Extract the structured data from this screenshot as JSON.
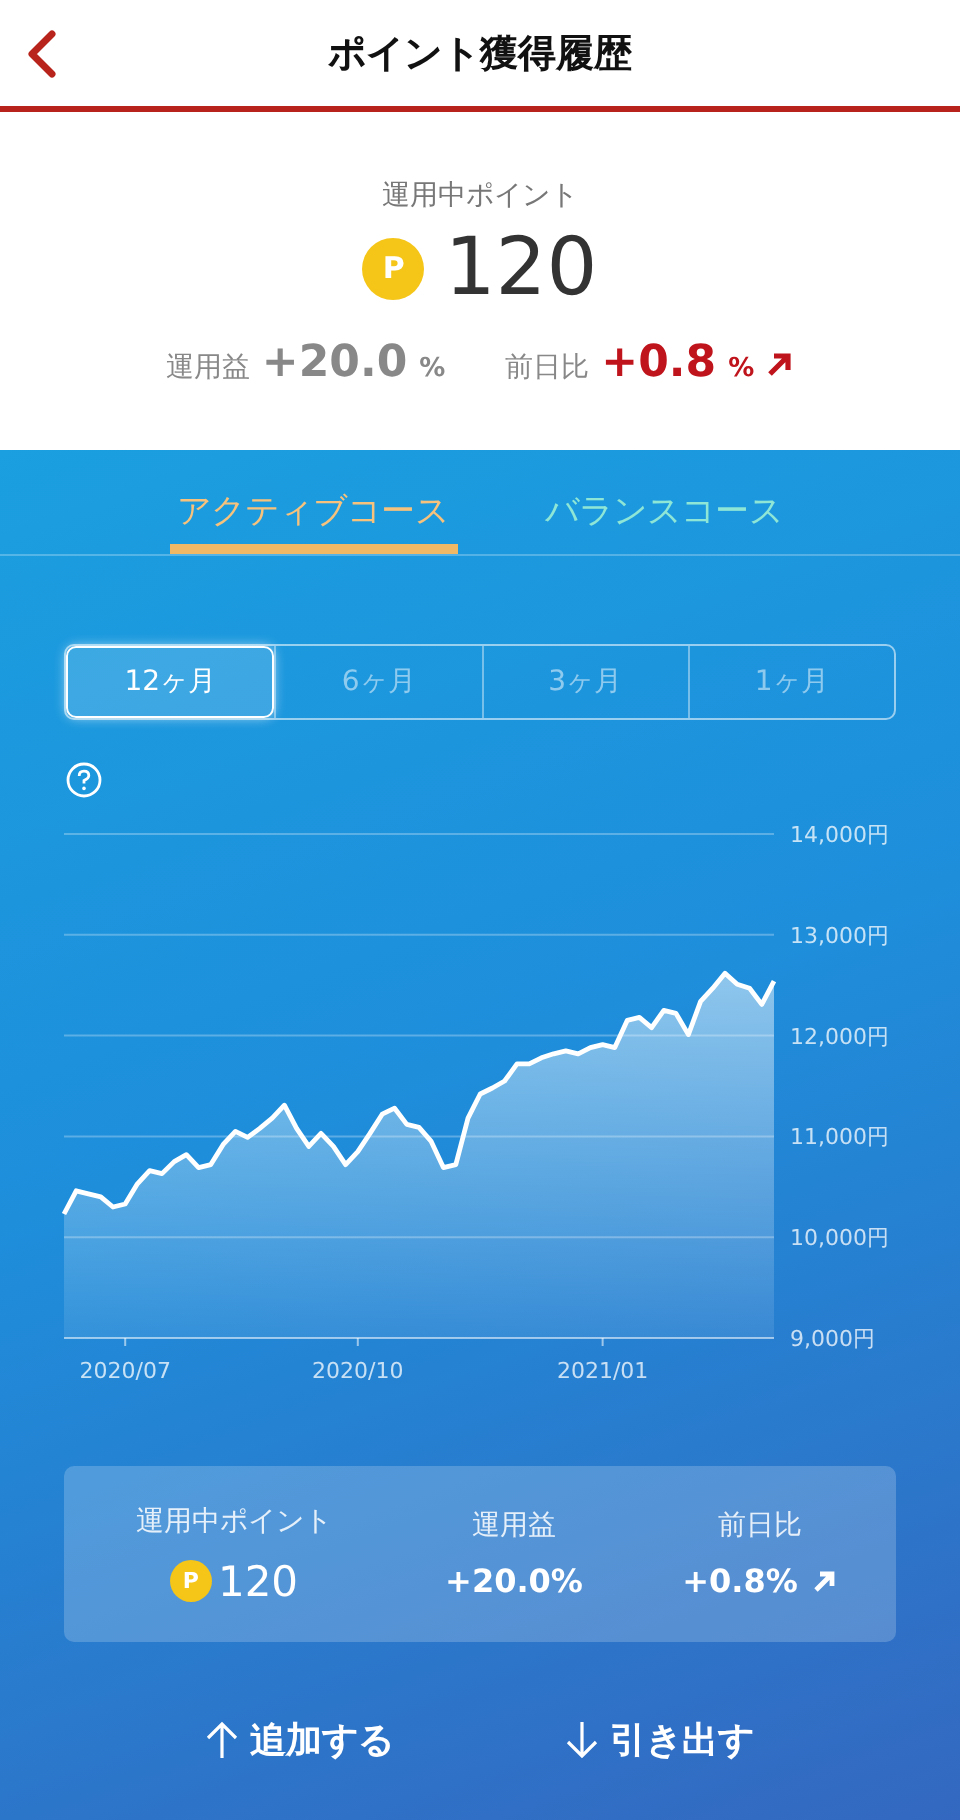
{
  "header": {
    "title": "ポイント獲得履歴"
  },
  "summary": {
    "label": "運用中ポイント",
    "coin_mark": "P",
    "points": "120",
    "profit_label": "運用益",
    "profit_value": "+20.0",
    "profit_unit": "%",
    "daychange_label": "前日比",
    "daychange_value": "+0.8",
    "daychange_unit": "%"
  },
  "course_tabs": [
    {
      "label": "アクティブコース",
      "selected": true
    },
    {
      "label": "バランスコース",
      "selected": false
    }
  ],
  "period_tabs": [
    {
      "label": "12ヶ月",
      "selected": true
    },
    {
      "label": "6ヶ月",
      "selected": false
    },
    {
      "label": "3ヶ月",
      "selected": false
    },
    {
      "label": "1ヶ月",
      "selected": false
    }
  ],
  "chart": {
    "chart_data": {
      "type": "area",
      "grid": true,
      "ylim": [
        9000,
        14000
      ],
      "categories": [
        null,
        null,
        null,
        null,
        null,
        "2020/07",
        null,
        null,
        null,
        null,
        null,
        null,
        null,
        null,
        null,
        null,
        null,
        null,
        null,
        null,
        null,
        null,
        null,
        null,
        "2020/10",
        null,
        null,
        null,
        null,
        null,
        null,
        null,
        null,
        null,
        null,
        null,
        null,
        null,
        null,
        null,
        null,
        null,
        null,
        null,
        "2021/01",
        null,
        null,
        null,
        null,
        null,
        null,
        null,
        null,
        null,
        null,
        null,
        null,
        null,
        null
      ],
      "yticks": [
        {
          "value": 14000,
          "label": "14,000円"
        },
        {
          "value": 13000,
          "label": "13,000円"
        },
        {
          "value": 12000,
          "label": "12,000円"
        },
        {
          "value": 11000,
          "label": "11,000円"
        },
        {
          "value": 10000,
          "label": "10,000円"
        },
        {
          "value": 9000,
          "label": "9,000円"
        }
      ],
      "series": [
        {
          "color": "#ffffff",
          "values": [
            10230,
            10460,
            10430,
            10400,
            10300,
            10330,
            10530,
            10660,
            10630,
            10750,
            10820,
            10690,
            10720,
            10920,
            11050,
            10990,
            11080,
            11180,
            11310,
            11080,
            10900,
            11030,
            10900,
            10720,
            10850,
            11030,
            11220,
            11280,
            11120,
            11090,
            10950,
            10690,
            10720,
            11180,
            11420,
            11480,
            11550,
            11720,
            11720,
            11780,
            11820,
            11850,
            11820,
            11880,
            11910,
            11880,
            12150,
            12180,
            12080,
            12250,
            12220,
            12010,
            12340,
            12470,
            12620,
            12510,
            12470,
            12310,
            12540
          ]
        }
      ]
    }
  },
  "card": {
    "coin_mark": "P",
    "columns": [
      {
        "label": "運用中ポイント",
        "value": "120",
        "kind": "points"
      },
      {
        "label": "運用益",
        "value": "+20.0%",
        "kind": "plain"
      },
      {
        "label": "前日比",
        "value": "+0.8%",
        "kind": "trend"
      }
    ]
  },
  "actions": [
    {
      "label": "追加する",
      "kind": "deposit"
    },
    {
      "label": "引き出す",
      "kind": "withdraw"
    }
  ]
}
